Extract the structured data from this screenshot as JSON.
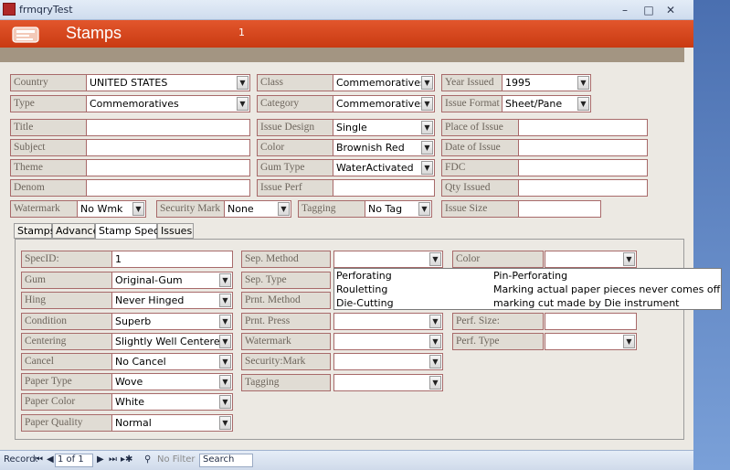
{
  "window": {
    "title": "frmqryTest",
    "min": "–",
    "max": "□",
    "close": "✕"
  },
  "header": {
    "title": "Stamps",
    "record_number": "1"
  },
  "form": {
    "country": {
      "label": "Country",
      "value": "UNITED STATES"
    },
    "type": {
      "label": "Type",
      "value": "Commemoratives"
    },
    "title": {
      "label": "Title",
      "value": ""
    },
    "subject": {
      "label": "Subject",
      "value": ""
    },
    "theme": {
      "label": "Theme",
      "value": ""
    },
    "denom": {
      "label": "Denom",
      "value": ""
    },
    "watermark": {
      "label": "Watermark",
      "value": "No Wmk"
    },
    "class": {
      "label": "Class",
      "value": "Commemoratives"
    },
    "category": {
      "label": "Category",
      "value": "Commemoratives"
    },
    "issue_design": {
      "label": "Issue Design",
      "value": "Single"
    },
    "color": {
      "label": "Color",
      "value": "Brownish Red"
    },
    "gum_type": {
      "label": "Gum Type",
      "value": "WaterActivated"
    },
    "issue_perf": {
      "label": "Issue Perf",
      "value": ""
    },
    "security_mark": {
      "label": "Security Mark",
      "value": "None"
    },
    "tagging": {
      "label": "Tagging",
      "value": "No Tag"
    },
    "year_issued": {
      "label": "Year Issued",
      "value": "1995"
    },
    "issue_format": {
      "label": "Issue Format",
      "value": "Sheet/Pane"
    },
    "place_of_issue": {
      "label": "Place of Issue",
      "value": ""
    },
    "date_of_issue": {
      "label": "Date of Issue",
      "value": ""
    },
    "fdc": {
      "label": "FDC",
      "value": ""
    },
    "qty_issued": {
      "label": "Qty Issued",
      "value": ""
    },
    "issue_size": {
      "label": "Issue Size",
      "value": ""
    }
  },
  "tabs": [
    "Stamps",
    "Advance",
    "Stamp Specs",
    "Issues"
  ],
  "specs": {
    "specid": {
      "label": "SpecID:",
      "value": "1"
    },
    "gum": {
      "label": "Gum",
      "value": "Original-Gum"
    },
    "hing": {
      "label": "Hing",
      "value": "Never Hinged"
    },
    "condition": {
      "label": "Condition",
      "value": "Superb"
    },
    "centering": {
      "label": "Centering",
      "value": "Slightly Well Centered"
    },
    "cancel": {
      "label": "Cancel",
      "value": "No Cancel"
    },
    "paper_type": {
      "label": "Paper Type",
      "value": "Wove"
    },
    "paper_color": {
      "label": "Paper Color",
      "value": "White"
    },
    "paper_quality": {
      "label": "Paper Quality",
      "value": "Normal"
    },
    "sep_method": {
      "label": "Sep. Method",
      "value": ""
    },
    "sep_type": {
      "label": "Sep. Type"
    },
    "prnt_method": {
      "label": "Prnt. Method"
    },
    "prnt_press": {
      "label": "Prnt. Press",
      "value": ""
    },
    "watermark": {
      "label": "Watermark",
      "value": ""
    },
    "security_mark": {
      "label": "Security:Mark",
      "value": ""
    },
    "tagging": {
      "label": "Tagging",
      "value": ""
    },
    "color": {
      "label": "Color",
      "value": ""
    },
    "perf_size": {
      "label": "Perf. Size:",
      "value": ""
    },
    "perf_type": {
      "label": "Perf. Type",
      "value": ""
    }
  },
  "dropdown": [
    {
      "name": "Perforating",
      "desc": "Pin-Perforating"
    },
    {
      "name": "Rouletting",
      "desc": "Marking actual paper pieces never comes off"
    },
    {
      "name": "Die-Cutting",
      "desc": "marking cut made by Die instrument"
    }
  ],
  "status": {
    "record_label": "Record:",
    "record_value": "1 of 1",
    "filter": "No Filter",
    "search": "Search"
  }
}
